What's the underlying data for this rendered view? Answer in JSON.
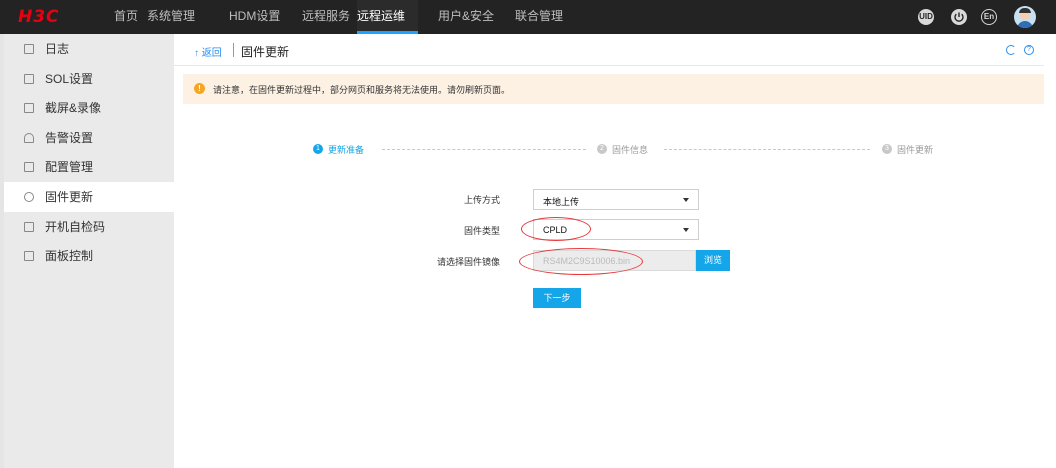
{
  "header": {
    "logo": "H3C",
    "nav": [
      "首页",
      "系统管理",
      "HDM设置",
      "远程服务",
      "远程运维",
      "用户&安全",
      "联合管理"
    ],
    "active_nav": "远程运维",
    "icons": [
      "uid-icon",
      "power-icon",
      "language-icon",
      "user-avatar-icon"
    ],
    "uid_label": "UID",
    "lang_label": "En"
  },
  "sidebar": {
    "items": [
      {
        "label": "日志",
        "icon": "log-icon"
      },
      {
        "label": "SOL设置",
        "icon": "sol-icon"
      },
      {
        "label": "截屏&录像",
        "icon": "screenshot-icon"
      },
      {
        "label": "告警设置",
        "icon": "alarm-icon"
      },
      {
        "label": "配置管理",
        "icon": "config-icon"
      },
      {
        "label": "固件更新",
        "icon": "firmware-icon"
      },
      {
        "label": "开机自检码",
        "icon": "post-code-icon"
      },
      {
        "label": "面板控制",
        "icon": "panel-icon"
      }
    ],
    "active": "固件更新"
  },
  "breadcrumb": {
    "back": "返回",
    "title": "固件更新"
  },
  "notice": {
    "text": "请注意，在固件更新过程中，部分网页和服务将无法使用。请勿刷新页面。"
  },
  "steps": [
    {
      "num": "1",
      "label": "更新准备"
    },
    {
      "num": "2",
      "label": "固件信息"
    },
    {
      "num": "3",
      "label": "固件更新"
    }
  ],
  "form": {
    "upload_method_label": "上传方式",
    "upload_method_value": "本地上传",
    "firmware_type_label": "固件类型",
    "firmware_type_value": "CPLD",
    "image_label": "请选择固件镜像",
    "image_value": "RS4M2C9S10006.bin",
    "browse_label": "浏览",
    "next_label": "下一步"
  },
  "colors": {
    "topbar": "#232323",
    "accent": "#14a6e8",
    "brand": "#e60012",
    "notice_bg": "#fdf1e4",
    "annotation": "#e53a3a"
  }
}
